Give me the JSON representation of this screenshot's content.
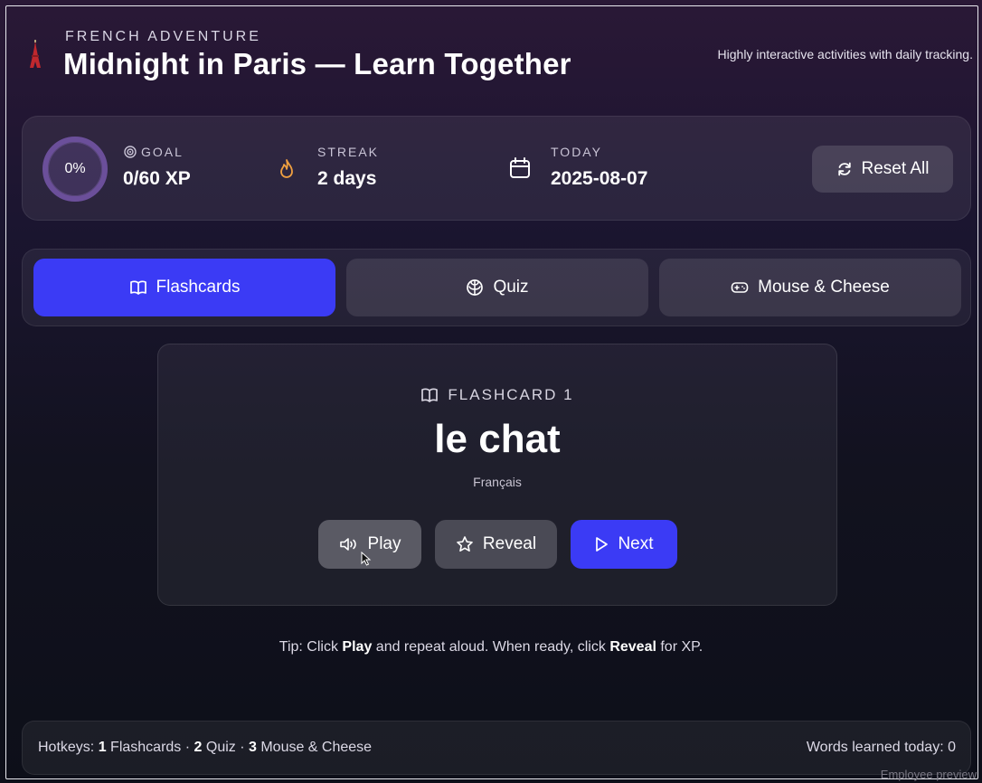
{
  "header": {
    "kicker": "FRENCH ADVENTURE",
    "title": "Midnight in Paris — Learn Together",
    "tagline": "Highly interactive activities with daily tracking.",
    "logo_icon": "eiffel-tower-icon"
  },
  "stats": {
    "progress_percent_text": "0%",
    "progress": 0,
    "goal_label": "GOAL",
    "goal_value": "0/60 XP",
    "streak_label": "STREAK",
    "streak_value": "2 days",
    "today_label": "TODAY",
    "today_value": "2025-08-07",
    "reset_label": "Reset All"
  },
  "tabs": [
    {
      "label": "Flashcards",
      "icon": "book-icon",
      "active": true
    },
    {
      "label": "Quiz",
      "icon": "brain-icon",
      "active": false
    },
    {
      "label": "Mouse & Cheese",
      "icon": "gamepad-icon",
      "active": false
    }
  ],
  "flashcard": {
    "kicker": "FLASHCARD 1",
    "word": "le chat",
    "language": "Français",
    "play_label": "Play",
    "reveal_label": "Reveal",
    "next_label": "Next"
  },
  "tip": {
    "prefix": "Tip: Click ",
    "play": "Play",
    "middle": " and repeat aloud. When ready, click ",
    "reveal": "Reveal",
    "suffix": " for XP."
  },
  "footer": {
    "hotkeys_prefix": "Hotkeys: ",
    "k1": "1",
    "k1_label": " Flashcards · ",
    "k2": "2",
    "k2_label": " Quiz · ",
    "k3": "3",
    "k3_label": " Mouse & Cheese",
    "words_today": "Words learned today: 0"
  },
  "watermark": "Employee preview",
  "colors": {
    "accent": "#3b3bf5",
    "streak_flame": "#f0a040"
  }
}
